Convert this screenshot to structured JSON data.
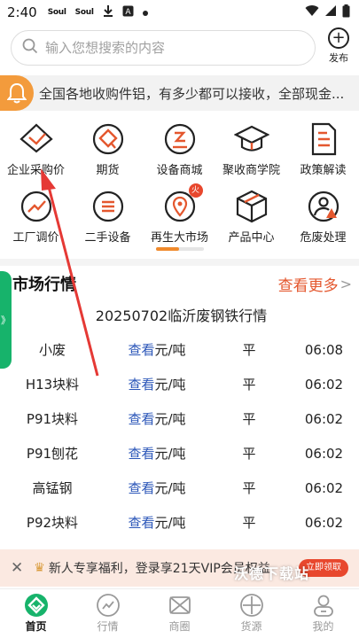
{
  "status_bar": {
    "time": "2:40",
    "icons": [
      "Soul",
      "Soul"
    ]
  },
  "search": {
    "placeholder": "输入您想搜索的内容"
  },
  "publish": {
    "label": "发布"
  },
  "notice": {
    "text": "全国各地收购件铝，有多少都可以接收，全部现金..."
  },
  "grid": {
    "items": [
      {
        "label": "企业采购价",
        "icon": "shield-check-icon"
      },
      {
        "label": "期货",
        "icon": "diamond-q-icon"
      },
      {
        "label": "设备商城",
        "icon": "coin-icon"
      },
      {
        "label": "聚收商学院",
        "icon": "graduation-cap-icon"
      },
      {
        "label": "政策解读",
        "icon": "document-icon"
      },
      {
        "label": "工厂调价",
        "icon": "trend-icon"
      },
      {
        "label": "二手设备",
        "icon": "equal-circle-icon"
      },
      {
        "label": "再生大市场",
        "icon": "map-pin-icon",
        "badge": "火"
      },
      {
        "label": "产品中心",
        "icon": "box-icon"
      },
      {
        "label": "危废处理",
        "icon": "person-warning-icon"
      }
    ]
  },
  "market": {
    "title": "市场行情",
    "more": "查看更多",
    "subtitle": "20250702临沂废钢铁行情",
    "rows": [
      {
        "name": "小废",
        "link": "查看",
        "unit": "元/吨",
        "trend": "平",
        "time": "06:08"
      },
      {
        "name": "H13块料",
        "link": "查看",
        "unit": "元/吨",
        "trend": "平",
        "time": "06:02"
      },
      {
        "name": "P91块料",
        "link": "查看",
        "unit": "元/吨",
        "trend": "平",
        "time": "06:02"
      },
      {
        "name": "P91刨花",
        "link": "查看",
        "unit": "元/吨",
        "trend": "平",
        "time": "06:02"
      },
      {
        "name": "高锰钢",
        "link": "查看",
        "unit": "元/吨",
        "trend": "平",
        "time": "06:02"
      },
      {
        "name": "P92块料",
        "link": "查看",
        "unit": "元/吨",
        "trend": "平",
        "time": "06:02"
      }
    ]
  },
  "side_tab": {
    "label": "》"
  },
  "promo": {
    "text": "新人专享福利，登录享21天VIP会员权益",
    "button": "立即领取"
  },
  "watermark": "沃德下载站",
  "tabbar": {
    "items": [
      {
        "label": "首页",
        "icon": "home-icon",
        "active": true
      },
      {
        "label": "行情",
        "icon": "chart-icon"
      },
      {
        "label": "商圈",
        "icon": "bowtie-icon"
      },
      {
        "label": "货源",
        "icon": "target-icon"
      },
      {
        "label": "我的",
        "icon": "user-icon"
      }
    ]
  },
  "colors": {
    "accent": "#e4572e",
    "orange": "#f39b3c",
    "green": "#17b36b",
    "link": "#2a55b8"
  }
}
